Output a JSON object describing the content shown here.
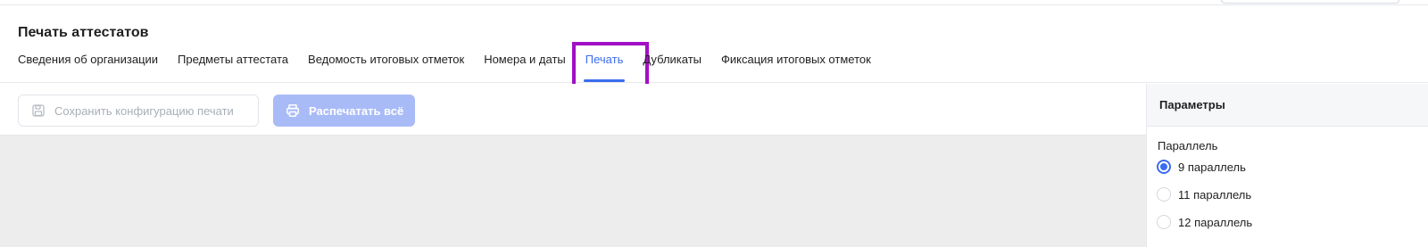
{
  "page": {
    "title": "Печать аттестатов"
  },
  "tabs": [
    {
      "label": "Сведения об организации"
    },
    {
      "label": "Предметы аттестата"
    },
    {
      "label": "Ведомость итоговых отметок"
    },
    {
      "label": "Номера и даты"
    },
    {
      "label": "Печать",
      "active": true
    },
    {
      "label": "Дубликаты"
    },
    {
      "label": "Фиксация итоговых отметок"
    }
  ],
  "toolbar": {
    "save_label": "Сохранить конфигурацию печати",
    "print_label": "Распечатать всё"
  },
  "params": {
    "title": "Параметры",
    "group_label": "Параллель",
    "options": [
      {
        "label": "9 параллель",
        "checked": true
      },
      {
        "label": "11 параллель",
        "checked": false
      },
      {
        "label": "12 параллель",
        "checked": false
      }
    ]
  },
  "colors": {
    "accent": "#3b6cf0",
    "highlight_box": "#a20fc4",
    "disabled_primary": "#a9bbf7"
  },
  "icons": {
    "save": "floppy-disk-icon",
    "print": "printer-icon"
  }
}
